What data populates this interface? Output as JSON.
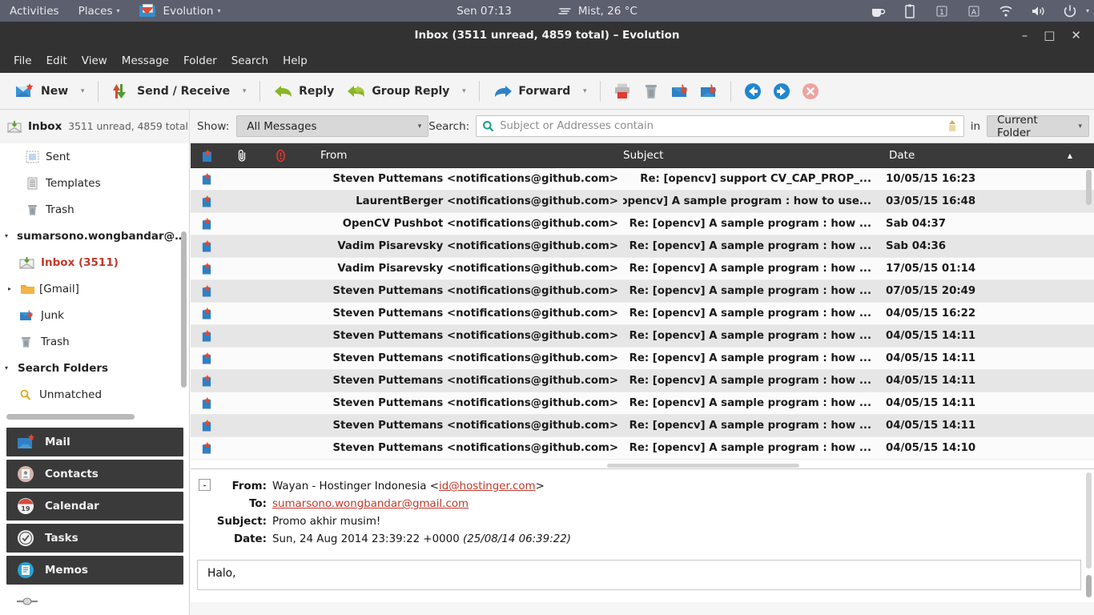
{
  "topbar": {
    "activities": "Activities",
    "places": "Places",
    "app_menu": "Evolution",
    "clock": "Sen 07:13",
    "weather": "Mist, 26 °C",
    "tray_icons": [
      "coffee-icon",
      "clipboard-icon",
      "keyboard-layout-1-icon",
      "accessibility-a-icon",
      "wifi-icon",
      "volume-icon",
      "power-icon",
      "dropdown-caret-icon"
    ],
    "caret": "▾"
  },
  "window": {
    "title": "Inbox (3511 unread, 4859 total) – Evolution",
    "minimize": "–",
    "maximize": "□",
    "close": "✕"
  },
  "menubar": {
    "items": [
      "File",
      "Edit",
      "View",
      "Message",
      "Folder",
      "Search",
      "Help"
    ]
  },
  "toolbar": {
    "new_label": "New",
    "send_receive_label": "Send / Receive",
    "reply_label": "Reply",
    "group_reply_label": "Group Reply",
    "forward_label": "Forward",
    "dropdown_caret": "▾",
    "icon_buttons": [
      "print-icon",
      "delete-icon",
      "junk-icon",
      "not-junk-icon",
      "previous-icon",
      "next-icon",
      "cancel-icon"
    ]
  },
  "searchbar": {
    "folder_name": "Inbox",
    "folder_counts": "3511 unread, 4859 total",
    "show_label": "Show:",
    "show_value": "All Messages",
    "search_label": "Search:",
    "search_value": "",
    "search_placeholder": "Subject or Addresses contain",
    "in_label": "in",
    "scope_value": "Current Folder",
    "caret": "▾"
  },
  "sidebar": {
    "folders": [
      {
        "label": "Sent",
        "icon": "sent-stamp-icon",
        "indent": 1,
        "triangle": "",
        "unread": false
      },
      {
        "label": "Templates",
        "icon": "templates-icon",
        "indent": 1,
        "triangle": "",
        "unread": false
      },
      {
        "label": "Trash",
        "icon": "trash-icon",
        "indent": 1,
        "triangle": "",
        "unread": false
      },
      {
        "label": "sumarsono.wongbandar@gmail",
        "icon": "",
        "indent": 0,
        "triangle": "▾",
        "unread": false,
        "account": true
      },
      {
        "label": "Inbox (3511)",
        "icon": "inbox-icon",
        "indent": 1,
        "triangle": "",
        "unread": true
      },
      {
        "label": "[Gmail]",
        "icon": "folder-icon",
        "indent": 1,
        "triangle": "▸",
        "unread": false
      },
      {
        "label": "Junk",
        "icon": "junk-icon",
        "indent": 1,
        "triangle": "",
        "unread": false
      },
      {
        "label": "Trash",
        "icon": "trash-icon",
        "indent": 1,
        "triangle": "",
        "unread": false
      },
      {
        "label": "Search Folders",
        "icon": "",
        "indent": 0,
        "triangle": "▾",
        "unread": false,
        "account": true
      },
      {
        "label": "Unmatched",
        "icon": "search-folder-icon",
        "indent": 1,
        "triangle": "",
        "unread": false
      }
    ],
    "switcher": [
      {
        "label": "Mail",
        "icon": "mail-icon"
      },
      {
        "label": "Contacts",
        "icon": "contacts-icon"
      },
      {
        "label": "Calendar",
        "icon": "calendar-icon",
        "badge": "19"
      },
      {
        "label": "Tasks",
        "icon": "tasks-icon"
      },
      {
        "label": "Memos",
        "icon": "memos-icon"
      }
    ]
  },
  "message_list": {
    "columns": {
      "status": "status-column-icon",
      "attachment": "paperclip-icon",
      "importance": "importance-icon",
      "from": "From",
      "subject": "Subject",
      "date": "Date",
      "sort_arrow": "▲"
    },
    "rows": [
      {
        "from": "Steven Puttemans <notifications@github.com>",
        "subject": "Re: [opencv] support CV_CAP_PROP_...",
        "date": "10/05/15 16:23",
        "thread": false
      },
      {
        "from": "LaurentBerger <notifications@github.com>",
        "subject": "[opencv] A sample program  : how to use...",
        "date": "03/05/15 16:48",
        "thread": true
      },
      {
        "from": "OpenCV Pushbot <notifications@github.com>",
        "subject": "Re: [opencv] A sample program  : how ...",
        "date": "Sab 04:37",
        "thread": false
      },
      {
        "from": "Vadim Pisarevsky <notifications@github.com>",
        "subject": "Re: [opencv] A sample program  : how ...",
        "date": "Sab 04:36",
        "thread": false
      },
      {
        "from": "Vadim Pisarevsky <notifications@github.com>",
        "subject": "Re: [opencv] A sample program  : how ...",
        "date": "17/05/15 01:14",
        "thread": false
      },
      {
        "from": "Steven Puttemans <notifications@github.com>",
        "subject": "Re: [opencv] A sample program  : how ...",
        "date": "07/05/15 20:49",
        "thread": false
      },
      {
        "from": "Steven Puttemans <notifications@github.com>",
        "subject": "Re: [opencv] A sample program  : how ...",
        "date": "04/05/15 16:22",
        "thread": false
      },
      {
        "from": "Steven Puttemans <notifications@github.com>",
        "subject": "Re: [opencv] A sample program  : how ...",
        "date": "04/05/15 14:11",
        "thread": false
      },
      {
        "from": "Steven Puttemans <notifications@github.com>",
        "subject": "Re: [opencv] A sample program  : how ...",
        "date": "04/05/15 14:11",
        "thread": false
      },
      {
        "from": "Steven Puttemans <notifications@github.com>",
        "subject": "Re: [opencv] A sample program  : how ...",
        "date": "04/05/15 14:11",
        "thread": false
      },
      {
        "from": "Steven Puttemans <notifications@github.com>",
        "subject": "Re: [opencv] A sample program  : how ...",
        "date": "04/05/15 14:11",
        "thread": false
      },
      {
        "from": "Steven Puttemans <notifications@github.com>",
        "subject": "Re: [opencv] A sample program  : how ...",
        "date": "04/05/15 14:11",
        "thread": false
      },
      {
        "from": "Steven Puttemans <notifications@github.com>",
        "subject": "Re: [opencv] A sample program  : how ...",
        "date": "04/05/15 14:10",
        "thread": false
      }
    ]
  },
  "preview": {
    "collapse_symbol": "-",
    "from_label": "From:",
    "from_name": "Wayan - Hostinger Indonesia <",
    "from_email": "id@hostinger.com",
    "from_close": ">",
    "to_label": "To:",
    "to_value": "sumarsono.wongbandar@gmail.com",
    "subject_label": "Subject:",
    "subject_value": "Promo akhir musim!",
    "date_label": "Date:",
    "date_value": "Sun, 24 Aug 2014 23:39:22 +0000 ",
    "date_local": "(25/08/14 06:39:22)",
    "body_text": "Halo,"
  },
  "colors": {
    "topbar_bg": "#5c5f6e",
    "titlebar_bg": "#323232",
    "header_bg": "#3a3a3a",
    "unread_red": "#c0392b",
    "link_red": "#c0392b",
    "toolbar_bg": "#f4f4f4"
  }
}
